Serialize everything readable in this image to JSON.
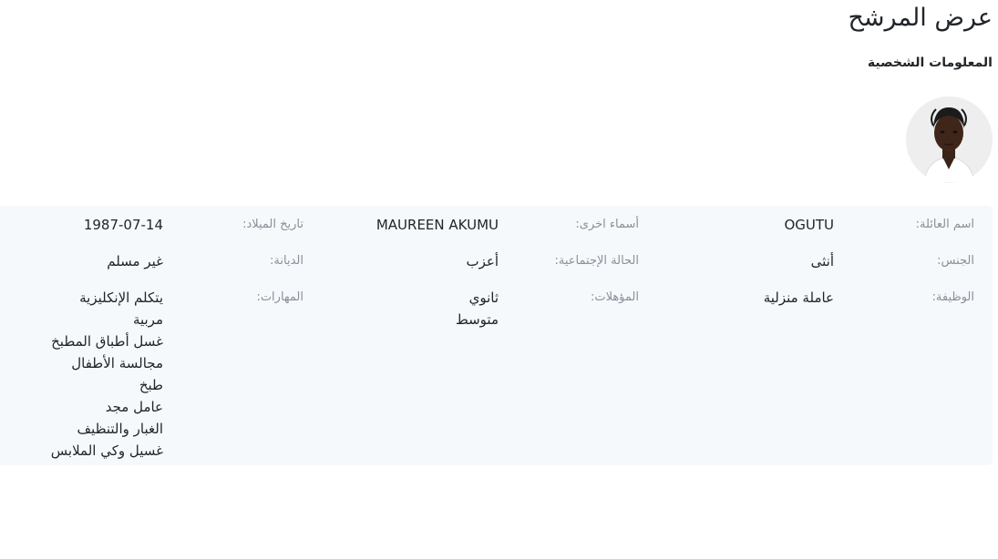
{
  "page": {
    "title": "عرض المرشح",
    "section_title": "المعلومات الشخصية"
  },
  "candidate": {
    "photo": "candidate-photo",
    "family_name_label": "اسم العائلة:",
    "family_name": "OGUTU",
    "other_names_label": "أسماء اخرى:",
    "other_names": "MAUREEN AKUMU",
    "birth_date_label": "تاريخ الميلاد:",
    "birth_date": "1987-07-14",
    "gender_label": "الجنس:",
    "gender": "أنثى",
    "marital_status_label": "الحالة الإجتماعية:",
    "marital_status": "أعزب",
    "religion_label": "الديانة:",
    "religion": "غير مسلم",
    "job_label": "الوظيفة:",
    "job": "عاملة منزلية",
    "qualifications_label": "المؤهلات:",
    "qualifications": [
      "ثانوي",
      "متوسط"
    ],
    "skills_label": "المهارات:",
    "skills": [
      "يتكلم الإنكليزية",
      "مربية",
      "غسل أطباق المطبخ",
      "مجالسة الأطفال",
      "طبخ",
      "عامل مجد",
      "الغبار والتنظيف",
      "غسيل وكي الملابس"
    ]
  }
}
